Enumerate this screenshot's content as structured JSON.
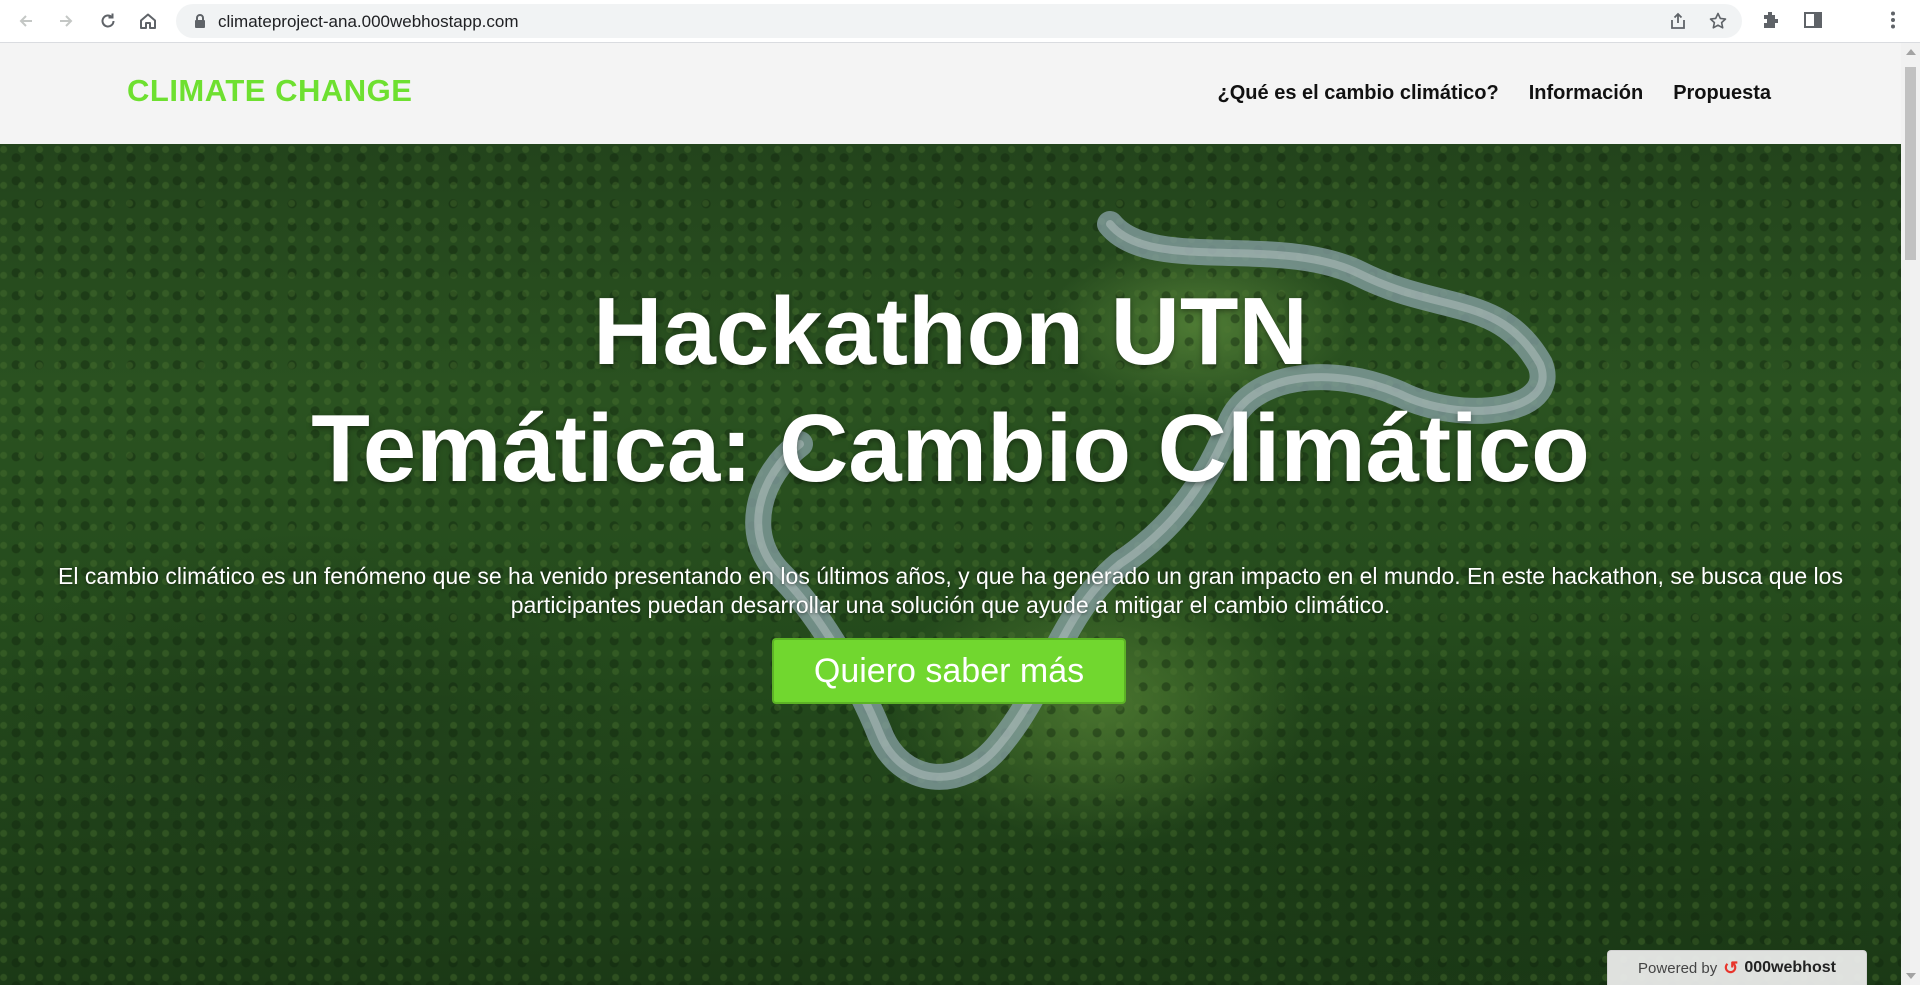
{
  "browser": {
    "url": "climateproject-ana.000webhostapp.com",
    "icons": [
      "back-icon",
      "forward-icon",
      "reload-icon",
      "home-icon",
      "lock-icon",
      "share-icon",
      "bookmark-star-icon",
      "extensions-icon",
      "side-panel-icon",
      "menu-kebab-icon"
    ]
  },
  "header": {
    "brand": "CLIMATE CHANGE",
    "brand_color": "#6ee030",
    "menu": [
      {
        "label": "¿Qué es el cambio climático?"
      },
      {
        "label": "Información"
      },
      {
        "label": "Propuesta"
      }
    ]
  },
  "hero": {
    "title_line1": "Hackathon UTN",
    "title_line2": "Temática: Cambio Climático",
    "description": "El cambio climático es un fenómeno que se ha venido presentando en los últimos años, y que ha generado un gran impacto en el mundo. En este hackathon, se busca que los participantes puedan desarrollar una solución que ayude a mitigar el cambio climático.",
    "cta_label": "Quiero saber más",
    "cta_color": "#71d72f"
  },
  "badge": {
    "prefix": "Powered by",
    "name": "000webhost"
  }
}
